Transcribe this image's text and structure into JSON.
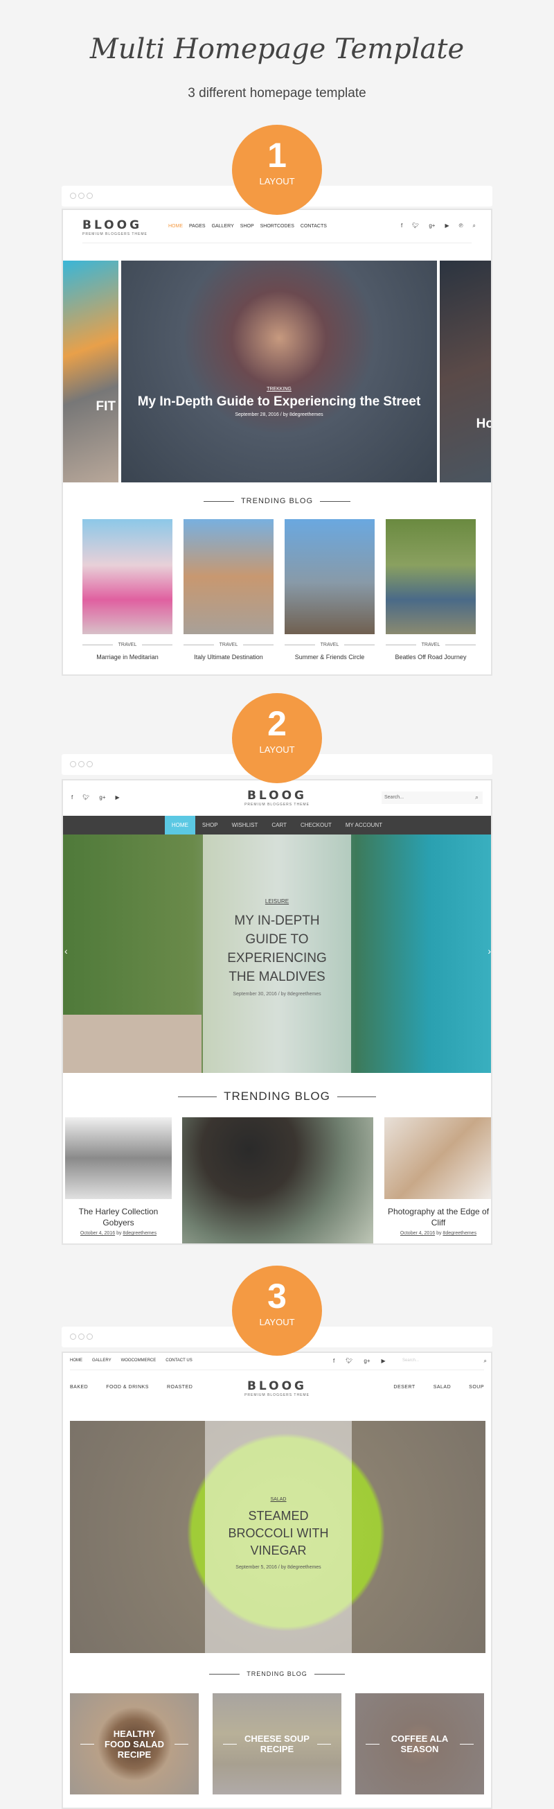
{
  "header": {
    "title": "Multi Homepage Template",
    "subtitle": "3 different homepage template"
  },
  "accent": "#f49a43",
  "layouts": [
    {
      "number": "1",
      "label": "LAYOUT",
      "logo": "BLOOG",
      "tagline": "PREMIUM BLOGGERS THEME",
      "nav": [
        "HOME",
        "PAGES",
        "GALLERY",
        "SHOP",
        "SHORTCODES",
        "CONTACTS"
      ],
      "social_icons": [
        "facebook-icon",
        "twitter-icon",
        "google-plus-icon",
        "youtube-icon",
        "pinterest-icon",
        "search-icon"
      ],
      "hero": {
        "left_peek": "FIT",
        "right_peek": "Ho",
        "category": "TREKKING",
        "title": "My In-Depth Guide to Experiencing the Street",
        "date": "September 28, 2016",
        "sep": "/",
        "author": "by 8degreethemes"
      },
      "trending": "TRENDING BLOG",
      "posts": [
        {
          "category": "TRAVEL",
          "title": "Marriage in Meditarian"
        },
        {
          "category": "TRAVEL",
          "title": "Italy Ultimate Destination"
        },
        {
          "category": "TRAVEL",
          "title": "Summer & Friends Circle"
        },
        {
          "category": "TRAVEL",
          "title": "Beatles Off Road Journey"
        }
      ]
    },
    {
      "number": "2",
      "label": "LAYOUT",
      "logo": "BLOOG",
      "tagline": "PREMIUM BLOGGERS THEME",
      "social_icons": [
        "facebook-icon",
        "twitter-icon",
        "google-plus-icon",
        "youtube-icon"
      ],
      "search_placeholder": "Search...",
      "nav": [
        "HOME",
        "SHOP",
        "WISHLIST",
        "CART",
        "CHECKOUT",
        "MY ACCOUNT"
      ],
      "hero": {
        "category": "LEISURE",
        "title": "MY IN-DEPTH GUIDE TO EXPERIENCING THE MALDIVES",
        "date": "September 30, 2016",
        "sep": "/",
        "author": "by 8degreethemes"
      },
      "trending": "TRENDING BLOG",
      "posts": [
        {
          "title": "The Harley Collection Gobyers",
          "date": "October 4, 2016",
          "author_prefix": "by",
          "author": "8degreethemes"
        },
        {
          "title": "Photography at the Edge of Cliff",
          "date": "October 4, 2016",
          "author_prefix": "by",
          "author": "8degreethemes"
        }
      ]
    },
    {
      "number": "3",
      "label": "LAYOUT",
      "top_nav": [
        "HOME",
        "GALLERY",
        "WOOCOMMERCE",
        "CONTACT US"
      ],
      "social_icons": [
        "facebook-icon",
        "twitter-icon",
        "google-plus-icon",
        "youtube-icon"
      ],
      "search_placeholder": "Search...",
      "logo": "BLOOG",
      "tagline": "PREMIUM BLOGGERS THEME",
      "nav_left": [
        "BAKED",
        "FOOD & DRINKS",
        "ROASTED"
      ],
      "nav_right": [
        "DESERT",
        "SALAD",
        "SOUP"
      ],
      "hero": {
        "category": "SALAD",
        "title": "STEAMED BROCCOLI WITH VINEGAR",
        "date": "September 5, 2016",
        "sep": "/",
        "author": "by 8degreethemes"
      },
      "trending": "TRENDING BLOG",
      "posts": [
        {
          "title": "HEALTHY FOOD SALAD RECIPE"
        },
        {
          "title": "CHEESE SOUP RECIPE"
        },
        {
          "title": "COFFEE ALA SEASON"
        }
      ]
    }
  ]
}
